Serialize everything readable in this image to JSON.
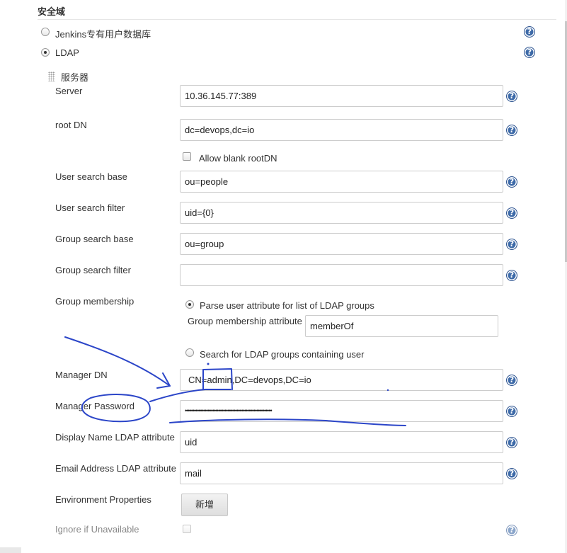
{
  "section": {
    "title": "安全域"
  },
  "realm_options": [
    {
      "label": "Jenkins专有用户数据库",
      "selected": false
    },
    {
      "label": "LDAP",
      "selected": true
    }
  ],
  "server_group": {
    "title": "服务器"
  },
  "fields": {
    "server": {
      "label": "Server",
      "value": "10.36.145.77:389"
    },
    "root_dn": {
      "label": "root DN",
      "value": "dc=devops,dc=io"
    },
    "allow_blank_root_dn": {
      "label": "Allow blank rootDN",
      "checked": false
    },
    "user_search_base": {
      "label": "User search base",
      "value": "ou=people"
    },
    "user_search_filter": {
      "label": "User search filter",
      "value": "uid={0}"
    },
    "group_search_base": {
      "label": "Group search base",
      "value": "ou=group"
    },
    "group_search_filter": {
      "label": "Group search filter",
      "value": ""
    },
    "group_membership": {
      "label": "Group membership",
      "option_parse": "Parse user attribute for list of LDAP groups",
      "attribute_label": "Group membership attribute",
      "attribute_value": "memberOf",
      "option_search": "Search for LDAP groups containing user"
    },
    "manager_dn": {
      "label": "Manager DN",
      "value": "CN=admin,DC=devops,DC=io"
    },
    "manager_password": {
      "label": "Manager Password",
      "value": "•••••••••••••••••••••••••••••••••••••••••••••••••••••••••"
    },
    "display_name_attr": {
      "label": "Display Name LDAP attribute",
      "value": "uid"
    },
    "email_attr": {
      "label": "Email Address LDAP attribute",
      "value": "mail"
    },
    "env_properties": {
      "label": "Environment Properties",
      "button": "新增"
    },
    "ignore_unavailable": {
      "label": "Ignore if Unavailable",
      "checked": false
    }
  },
  "help_icon_glyph": "?",
  "colors": {
    "help_icon": "#3d6aa8",
    "annotation": "#2b45c8"
  }
}
